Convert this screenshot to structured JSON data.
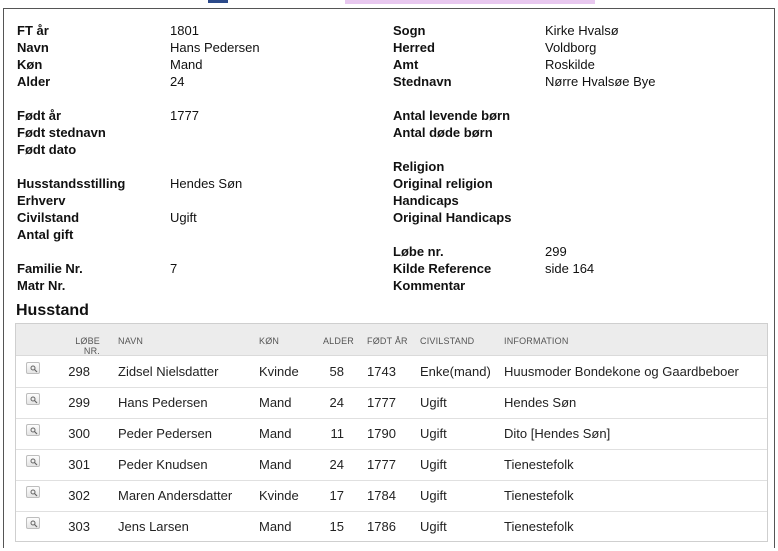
{
  "fields": {
    "ft_aar": {
      "label": "FT år",
      "value": "1801"
    },
    "navn": {
      "label": "Navn",
      "value": "Hans Pedersen"
    },
    "koen": {
      "label": "Køn",
      "value": "Mand"
    },
    "alder": {
      "label": "Alder",
      "value": "24"
    },
    "foedt_aar": {
      "label": "Født år",
      "value": "1777"
    },
    "foedt_stednavn": {
      "label": "Født stednavn",
      "value": ""
    },
    "foedt_dato": {
      "label": "Født dato",
      "value": ""
    },
    "husstandsstilling": {
      "label": "Husstandsstilling",
      "value": "Hendes Søn"
    },
    "erhverv": {
      "label": "Erhverv",
      "value": ""
    },
    "civilstand": {
      "label": "Civilstand",
      "value": "Ugift"
    },
    "antal_gift": {
      "label": "Antal gift",
      "value": ""
    },
    "familie_nr": {
      "label": "Familie Nr.",
      "value": "7"
    },
    "matr_nr": {
      "label": "Matr Nr.",
      "value": ""
    },
    "sogn": {
      "label": "Sogn",
      "value": "Kirke Hvalsø"
    },
    "herred": {
      "label": "Herred",
      "value": "Voldborg"
    },
    "amt": {
      "label": "Amt",
      "value": "Roskilde"
    },
    "stednavn": {
      "label": "Stednavn",
      "value": "Nørre Hvalsøe Bye"
    },
    "antal_levende_boern": {
      "label": "Antal levende børn",
      "value": ""
    },
    "antal_doede_boern": {
      "label": "Antal døde børn",
      "value": ""
    },
    "religion": {
      "label": "Religion",
      "value": ""
    },
    "original_religion": {
      "label": "Original religion",
      "value": ""
    },
    "handicaps": {
      "label": "Handicaps",
      "value": ""
    },
    "original_handicaps": {
      "label": "Original Handicaps",
      "value": ""
    },
    "loebe_nr": {
      "label": "Løbe nr.",
      "value": "299"
    },
    "kilde_reference": {
      "label": "Kilde Reference",
      "value": "side 164"
    },
    "kommentar": {
      "label": "Kommentar",
      "value": ""
    }
  },
  "husstand": {
    "title": "Husstand",
    "headers": {
      "loebe_nr": "LØBE NR.",
      "navn": "NAVN",
      "koen": "KØN",
      "alder": "ALDER",
      "foedt_aar": "FØDT ÅR",
      "civilstand": "CIVILSTAND",
      "information": "INFORMATION"
    },
    "rows": [
      {
        "loebe_nr": "298",
        "navn": "Zidsel Nielsdatter",
        "koen": "Kvinde",
        "alder": "58",
        "foedt_aar": "1743",
        "civilstand": "Enke(mand)",
        "information": "Huusmoder Bondekone og Gaardbeboer"
      },
      {
        "loebe_nr": "299",
        "navn": "Hans Pedersen",
        "koen": "Mand",
        "alder": "24",
        "foedt_aar": "1777",
        "civilstand": "Ugift",
        "information": "Hendes Søn"
      },
      {
        "loebe_nr": "300",
        "navn": "Peder Pedersen",
        "koen": "Mand",
        "alder": "11",
        "foedt_aar": "1790",
        "civilstand": "Ugift",
        "information": "Dito [Hendes Søn]"
      },
      {
        "loebe_nr": "301",
        "navn": "Peder Knudsen",
        "koen": "Mand",
        "alder": "24",
        "foedt_aar": "1777",
        "civilstand": "Ugift",
        "information": "Tienestefolk"
      },
      {
        "loebe_nr": "302",
        "navn": "Maren Andersdatter",
        "koen": "Kvinde",
        "alder": "17",
        "foedt_aar": "1784",
        "civilstand": "Ugift",
        "information": "Tienestefolk"
      },
      {
        "loebe_nr": "303",
        "navn": "Jens Larsen",
        "koen": "Mand",
        "alder": "15",
        "foedt_aar": "1786",
        "civilstand": "Ugift",
        "information": "Tienestefolk"
      }
    ]
  },
  "icons": {
    "row_view": "magnifier-icon"
  }
}
